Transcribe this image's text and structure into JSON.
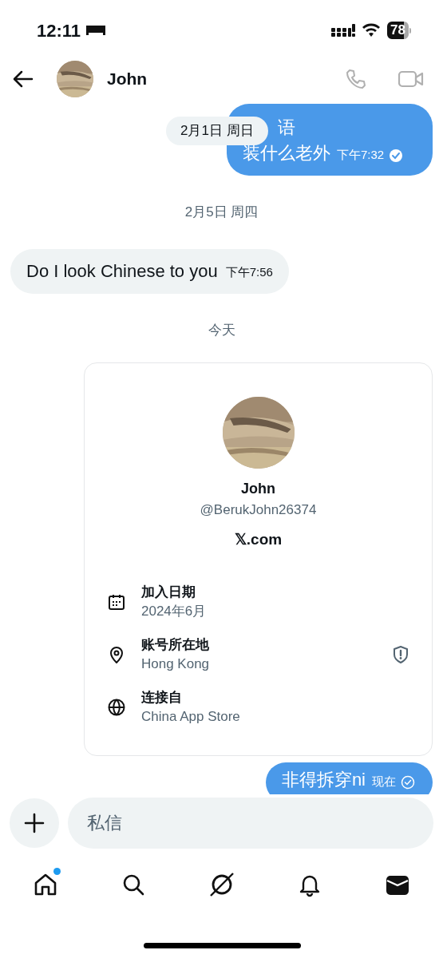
{
  "status_bar": {
    "time": "12:11",
    "battery": "78"
  },
  "header": {
    "name": "John"
  },
  "messages": [
    {
      "kind": "outgoing",
      "lines": [
        "语",
        "装什么老外"
      ],
      "time": "下午7:32",
      "read": true,
      "overlay_date": "2月1日 周日"
    },
    {
      "kind": "date",
      "text": "2月5日 周四"
    },
    {
      "kind": "incoming",
      "lines": [
        "Do I look Chinese to you"
      ],
      "time": "下午7:56"
    },
    {
      "kind": "date",
      "text": "今天"
    },
    {
      "kind": "profile_card",
      "name": "John",
      "handle": "@BerukJohn26374",
      "site": "𝕏.com",
      "rows": [
        {
          "kind": "calendar",
          "label": "加入日期",
          "value": "2024年6月",
          "shield": false
        },
        {
          "kind": "location",
          "label": "账号所在地",
          "value": "Hong Kong",
          "shield": true
        },
        {
          "kind": "globe",
          "label": "连接自",
          "value": "China App Store",
          "shield": false
        }
      ]
    },
    {
      "kind": "outgoing",
      "lines": [
        "非得拆穿ni"
      ],
      "time": "现在",
      "read": false
    }
  ],
  "composer": {
    "placeholder": "私信"
  },
  "tabs": [
    {
      "kind": "home",
      "selected": false,
      "dot": true
    },
    {
      "kind": "search",
      "selected": false,
      "dot": false
    },
    {
      "kind": "grok",
      "selected": false,
      "dot": false
    },
    {
      "kind": "bell",
      "selected": false,
      "dot": false
    },
    {
      "kind": "mail",
      "selected": true,
      "dot": false
    }
  ]
}
